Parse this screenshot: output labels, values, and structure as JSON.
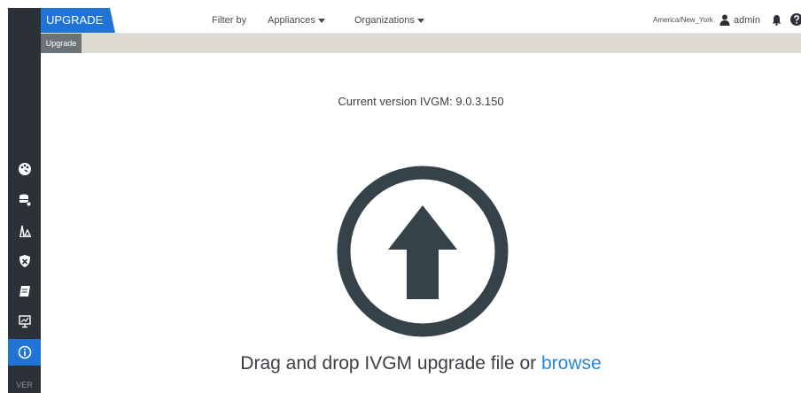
{
  "header": {
    "app_tab": "UPGRADE",
    "filter_label": "Filter by",
    "appliances_menu": "Appliances",
    "organizations_menu": "Organizations",
    "timezone": "America/New_York",
    "user": "admin"
  },
  "breadcrumb": {
    "label": "Upgrade"
  },
  "sidebar": {
    "icons": [
      "dashboard-icon",
      "database-icon",
      "analytics-icon",
      "shield-icon",
      "book-icon",
      "monitor-icon",
      "info-icon"
    ],
    "ver_label": "VER"
  },
  "main": {
    "version_label": "Current version IVGM: 9.0.3.150",
    "drop_text": "Drag and drop IVGM upgrade file or ",
    "browse_link": "browse"
  },
  "colors": {
    "accent": "#1f74d6",
    "sidebar_bg": "#2b3136",
    "link": "#2a86d8",
    "icon_dark": "#36424a"
  }
}
